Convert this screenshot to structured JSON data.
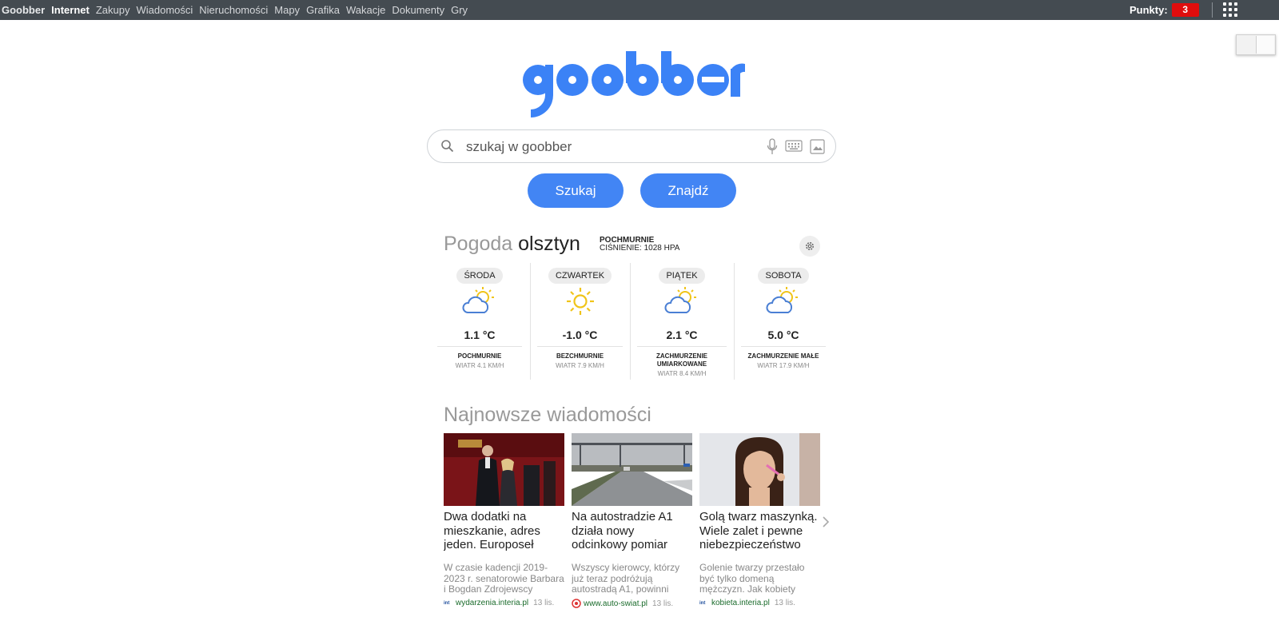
{
  "topnav": {
    "items": [
      "Goobber",
      "Internet",
      "Zakupy",
      "Wiadomości",
      "Nieruchomości",
      "Mapy",
      "Grafika",
      "Wakacje",
      "Dokumenty",
      "Gry"
    ],
    "points_label": "Punkty:",
    "points_value": "3"
  },
  "logo": {
    "text": "goobber",
    "color": "#3b82f6"
  },
  "search": {
    "placeholder": "szukaj w goobber",
    "buttons": [
      "Szukaj",
      "Znajdź"
    ]
  },
  "weather": {
    "label": "Pogoda",
    "city": "olsztyn",
    "condition": "POCHMURNIE",
    "pressure": "CIŚNIENIE: 1028 HPA",
    "days": [
      {
        "name": "ŚRODA",
        "icon": "cloud-sun-icon",
        "temp": "1.1 °C",
        "desc": "POCHMURNIE",
        "wind": "WIATR 4.1 KM/H"
      },
      {
        "name": "CZWARTEK",
        "icon": "sun-icon",
        "temp": "-1.0 °C",
        "desc": "BEZCHMURNIE",
        "wind": "WIATR 7.9 KM/H"
      },
      {
        "name": "PIĄTEK",
        "icon": "cloud-sun-icon",
        "temp": "2.1 °C",
        "desc": "ZACHMURZENIE UMIARKOWANE",
        "wind": "WIATR 8.4 KM/H"
      },
      {
        "name": "SOBOTA",
        "icon": "cloud-sun-icon",
        "temp": "5.0 °C",
        "desc": "ZACHMURZENIE MAŁE",
        "wind": "WIATR 17.9 KM/H"
      }
    ]
  },
  "news": {
    "title": "Najnowsze wiadomości",
    "cards": [
      {
        "headline": "Dwa dodatki na mieszkanie, adres jeden. Europoseł",
        "snippet": "W czasie kadencji 2019-2023 r. senatorowie Barbara i Bogdan Zdrojewscy",
        "source": "wydarzenia.interia.pl",
        "date": "13 lis."
      },
      {
        "headline": "Na autostradzie A1 działa nowy odcinkowy pomiar",
        "snippet": "Wszyscy kierowcy, którzy już teraz podróżują autostradą A1, powinni",
        "source": "www.auto-swiat.pl",
        "date": "13 lis."
      },
      {
        "headline": "Golą twarz maszynką. Wiele zalet i pewne niebezpieczeństwo",
        "snippet": "Golenie twarzy przestało być tylko domeną mężczyzn. Jak kobiety",
        "source": "kobieta.interia.pl",
        "date": "13 lis."
      }
    ]
  },
  "colors": {
    "topbar": "#444b51",
    "accent": "#4285f4",
    "badge": "#e00d0d"
  }
}
